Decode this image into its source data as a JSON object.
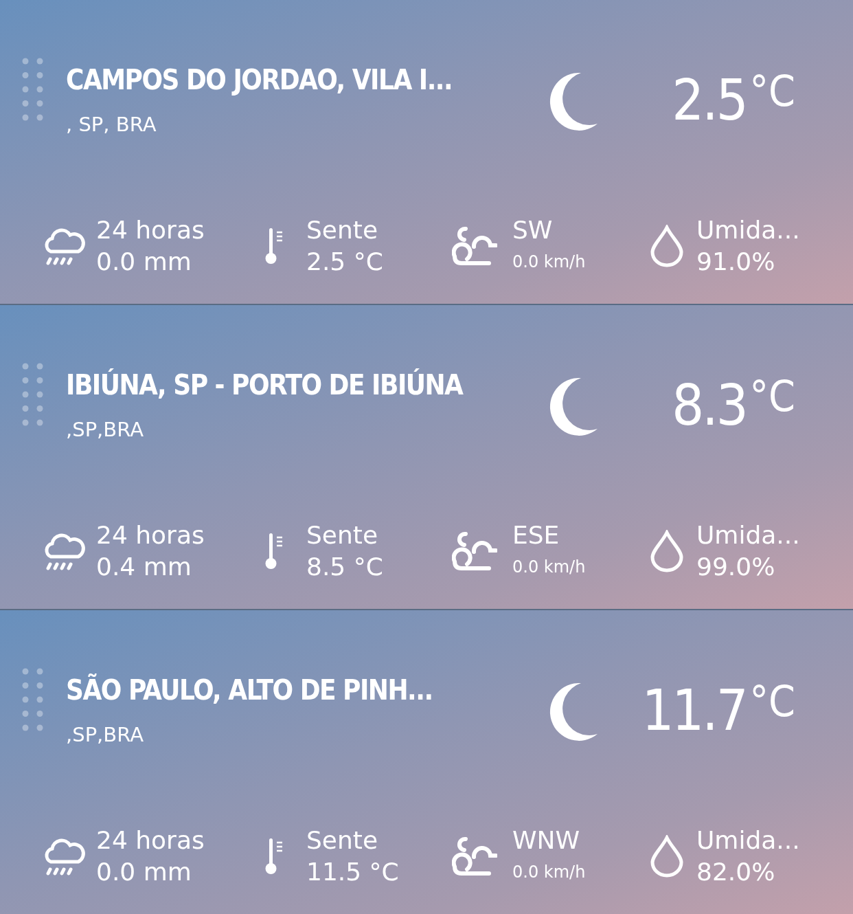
{
  "locations": [
    {
      "name": "CAMPOS DO JORDAO, VILA I...",
      "region": ", SP, BRA",
      "temperature": "2.5",
      "unit": "°C",
      "rain_label": "24 horas",
      "rain_value": "0.0 mm",
      "feels_label": "Sente",
      "feels_value": "2.5 °C",
      "wind_direction": "SW",
      "wind_speed": "0.0 km/h",
      "humidity_label": "Umida...",
      "humidity_value": "91.0%"
    },
    {
      "name": "IBIÚNA, SP - PORTO DE IBIÚNA",
      "region": ",SP,BRA",
      "temperature": "8.3",
      "unit": "°C",
      "rain_label": "24 horas",
      "rain_value": "0.4 mm",
      "feels_label": "Sente",
      "feels_value": "8.5 °C",
      "wind_direction": "ESE",
      "wind_speed": "0.0 km/h",
      "humidity_label": "Umida...",
      "humidity_value": "99.0%"
    },
    {
      "name": "SÃO PAULO, ALTO DE PINH...",
      "region": ",SP,BRA",
      "temperature": "11.7",
      "unit": "°C",
      "rain_label": "24 horas",
      "rain_value": "0.0 mm",
      "feels_label": "Sente",
      "feels_value": "11.5 °C",
      "wind_direction": "WNW",
      "wind_speed": "0.0 km/h",
      "humidity_label": "Umida...",
      "humidity_value": "82.0%"
    }
  ]
}
